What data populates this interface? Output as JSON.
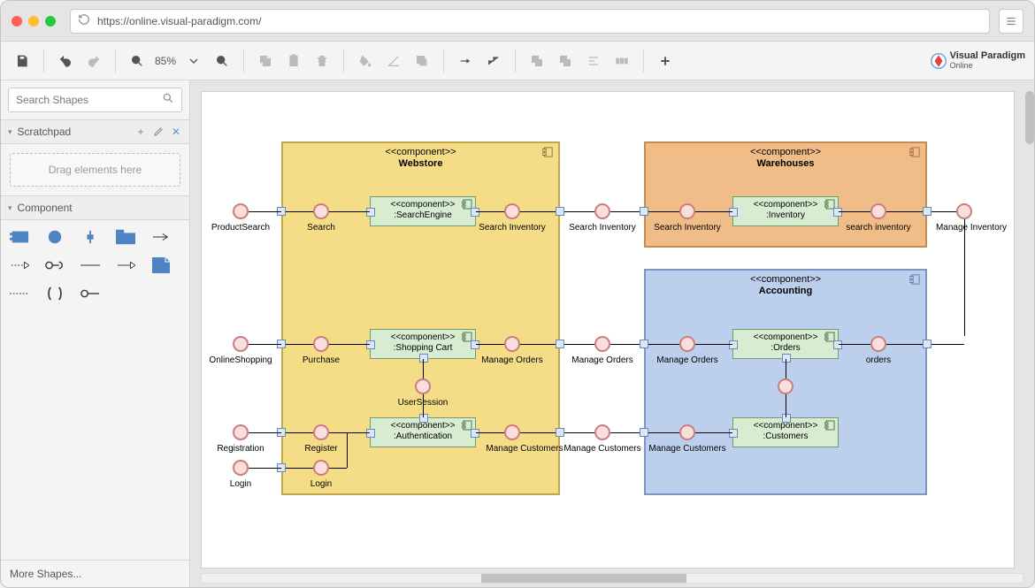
{
  "browser": {
    "url": "https://online.visual-paradigm.com/"
  },
  "brand": {
    "name": "Visual Paradigm",
    "sub": "Online"
  },
  "toolbar": {
    "zoom_label": "85%"
  },
  "sidebar": {
    "search_placeholder": "Search Shapes",
    "scratchpad_title": "Scratchpad",
    "scratchpad_hint": "Drag elements here",
    "component_title": "Component",
    "more_shapes": "More Shapes..."
  },
  "diagram": {
    "stereotype": "<<component>>",
    "containers": {
      "webstore": {
        "name": "Webstore"
      },
      "warehouses": {
        "name": "Warehouses"
      },
      "accounting": {
        "name": "Accounting"
      }
    },
    "inner_components": {
      "search_engine": ":SearchEngine",
      "inventory": ":Inventory",
      "shopping_cart": ":Shopping Cart",
      "authentication": ":Authentication",
      "orders": ":Orders",
      "customers": ":Customers"
    },
    "labels": {
      "product_search": "ProductSearch",
      "search": "Search",
      "search_inventory": "Search Inventory",
      "search_inventory2": "search inventory",
      "manage_inventory": "Manage Inventory",
      "online_shopping": "OnlineShopping",
      "purchase": "Purchase",
      "manage_orders": "Manage Orders",
      "orders": "orders",
      "user_session": "UserSession",
      "registration": "Registration",
      "register": "Register",
      "login": "Login",
      "manage_customers": "Manage Customers"
    }
  }
}
